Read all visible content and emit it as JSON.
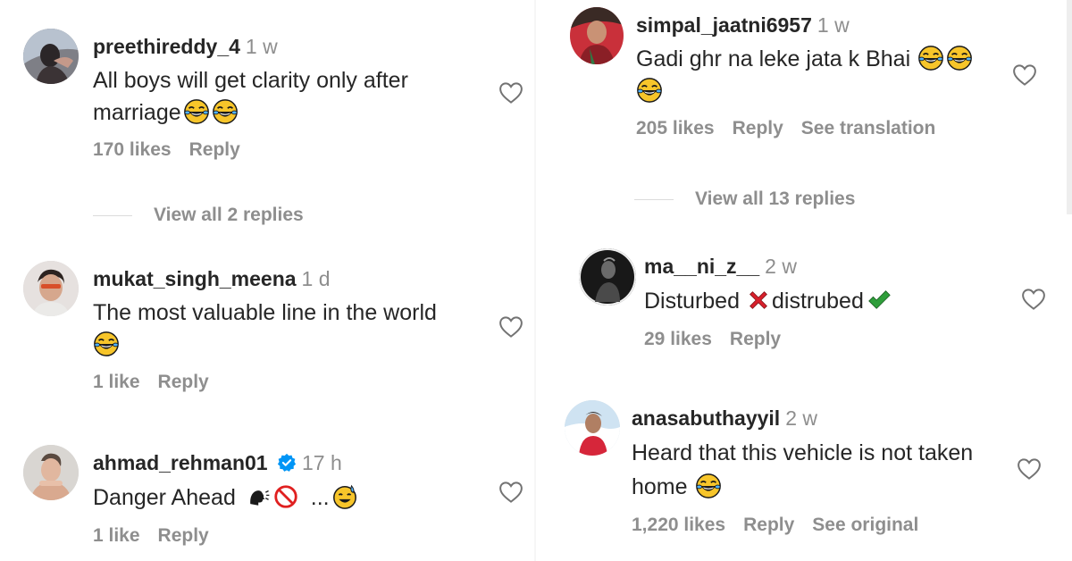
{
  "left": {
    "comments": [
      {
        "username": "preethireddy_4",
        "time": "1 w",
        "text_line1": "All boys will get clarity only after",
        "text_line2": "marriage",
        "likes": "170 likes",
        "reply_label": "Reply",
        "view_replies": "View all 2 replies"
      },
      {
        "username": "mukat_singh_meena",
        "time": "1 d",
        "text_line1": "The most valuable line in the world",
        "likes": "1 like",
        "reply_label": "Reply"
      },
      {
        "username": "ahmad_rehman01",
        "time": "17 h",
        "text_line1": "Danger Ahead",
        "text_suffix": "...",
        "likes": "1 like",
        "reply_label": "Reply"
      }
    ]
  },
  "right": {
    "comments": [
      {
        "username": "simpal_jaatni6957",
        "time": "1 w",
        "text_line1": "Gadi ghr na leke jata k Bhai",
        "likes": "205 likes",
        "reply_label": "Reply",
        "extra_label": "See translation",
        "view_replies": "View all 13 replies"
      },
      {
        "username": "ma__ni_z__",
        "time": "2 w",
        "text_part1": "Disturbed",
        "text_part2": "distrubed",
        "likes": "29 likes",
        "reply_label": "Reply"
      },
      {
        "username": "anasabuthayyil",
        "time": "2 w",
        "text_line1": "Heard that this vehicle is not taken",
        "text_line2": "home",
        "likes": "1,220 likes",
        "reply_label": "Reply",
        "extra_label": "See original"
      }
    ]
  },
  "colors": {
    "username": "#262626",
    "secondary": "#8e8e8e",
    "verified": "#0095f6"
  }
}
